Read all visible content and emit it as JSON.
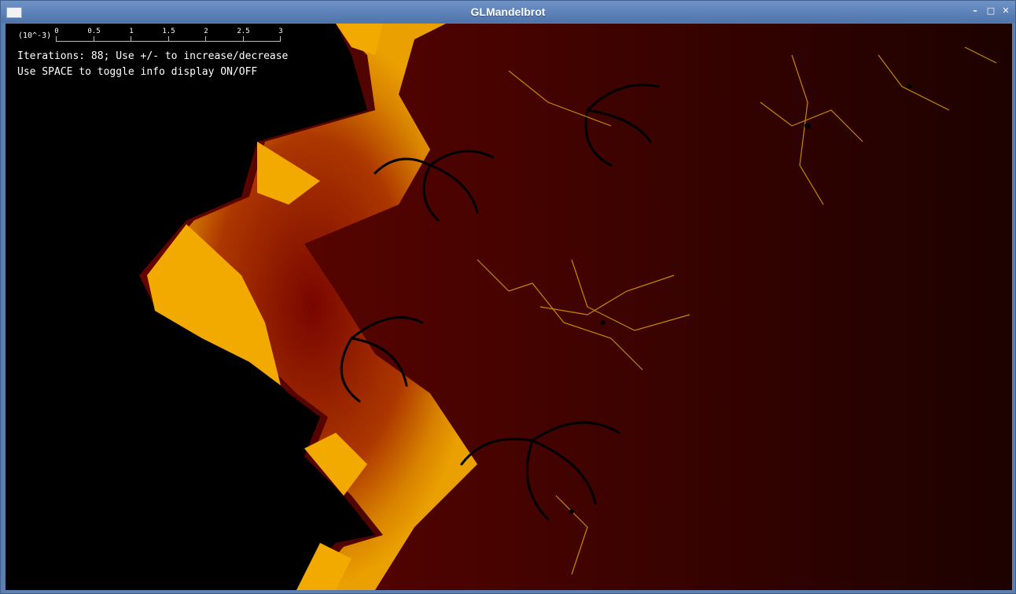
{
  "window": {
    "title": "GLMandelbrot",
    "controls": {
      "minimize": "–",
      "maximize": "□",
      "close": "✕"
    }
  },
  "info": {
    "scale_unit": "(10^-3)",
    "scale_ticks": [
      "0",
      "0.5",
      "1",
      "1.5",
      "2",
      "2.5",
      "3"
    ],
    "line1": "Iterations: 88; Use +/- to increase/decrease",
    "line2": "Use SPACE to toggle info display ON/OFF"
  },
  "colors": {
    "titlebar": "#5b7fb0",
    "fractal_outer": "#1c0200",
    "fractal_mid": "#6e0500",
    "fractal_edge": "#f2a900",
    "set": "#000000"
  }
}
